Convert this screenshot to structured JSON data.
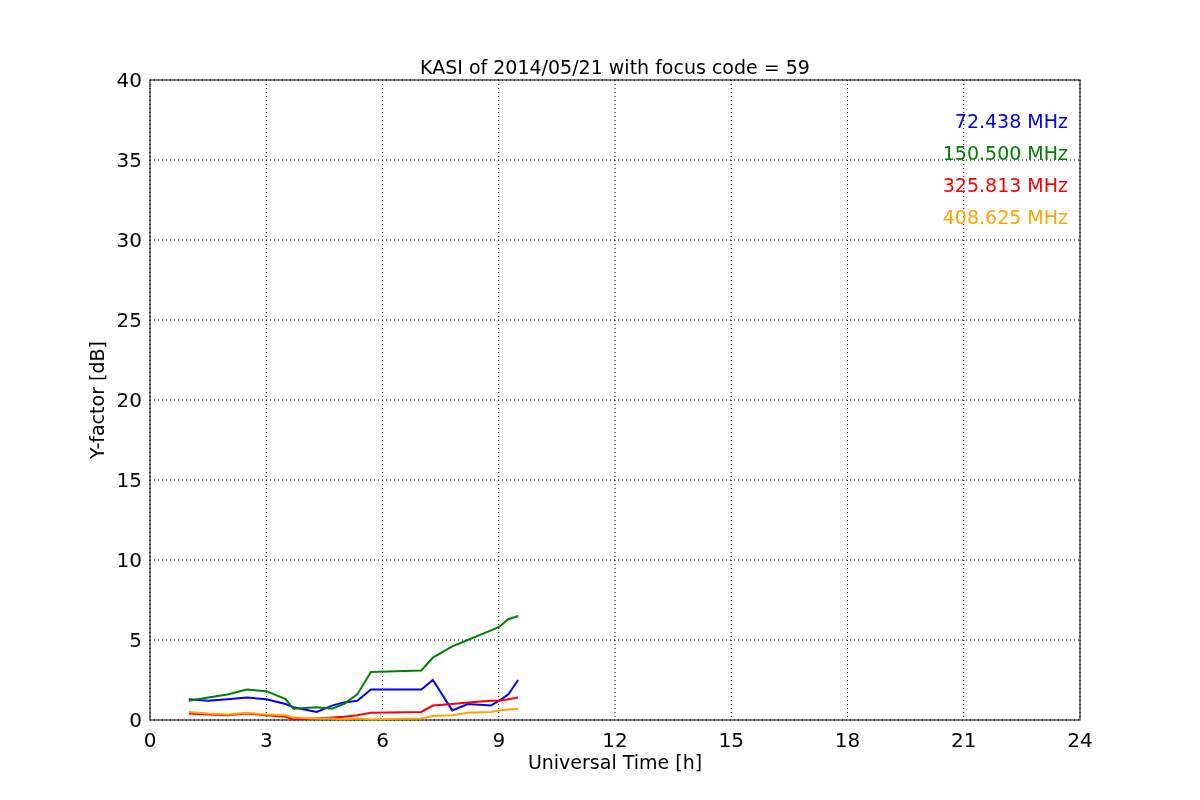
{
  "chart_data": {
    "type": "line",
    "title": "KASI of 2014/05/21 with focus code = 59",
    "xlabel": "Universal Time [h]",
    "ylabel": "Y-factor [dB]",
    "x": [
      1,
      1.5,
      2,
      2.5,
      3,
      3.5,
      3.7,
      4.3,
      4.7,
      5,
      5.35,
      5.7,
      7,
      7.3,
      7.8,
      8.2,
      8.8,
      9,
      9.25,
      9.5
    ],
    "series": [
      {
        "name": "72.438 MHz",
        "color": "#0000ff",
        "values": [
          1.3,
          1.2,
          1.3,
          1.4,
          1.3,
          1.0,
          0.8,
          0.5,
          0.9,
          1.1,
          1.2,
          1.9,
          1.9,
          2.5,
          0.6,
          1.0,
          0.9,
          1.2,
          1.6,
          2.5
        ]
      },
      {
        "name": "150.500 MHz",
        "color": "#008000",
        "values": [
          1.2,
          1.4,
          1.6,
          1.9,
          1.8,
          1.3,
          0.7,
          0.8,
          0.7,
          1.0,
          1.6,
          3.0,
          3.1,
          3.9,
          4.6,
          5.0,
          5.6,
          5.8,
          6.3,
          6.5
        ]
      },
      {
        "name": "325.813 MHz",
        "color": "#ff0000",
        "values": [
          0.4,
          0.35,
          0.3,
          0.4,
          0.3,
          0.2,
          0.05,
          0.1,
          0.15,
          0.2,
          0.3,
          0.45,
          0.5,
          0.9,
          1.0,
          1.1,
          1.2,
          1.2,
          1.3,
          1.4
        ]
      },
      {
        "name": "408.625 MHz",
        "color": "#ffa500",
        "values": [
          0.5,
          0.4,
          0.35,
          0.45,
          0.35,
          0.3,
          0.15,
          0.1,
          0.1,
          0.05,
          0.1,
          0.05,
          0.1,
          0.25,
          0.3,
          0.45,
          0.5,
          0.6,
          0.65,
          0.7
        ]
      }
    ],
    "grid": true,
    "xlim": [
      0,
      24
    ],
    "ylim": [
      0,
      40
    ],
    "xticks": [
      0,
      3,
      6,
      9,
      12,
      15,
      18,
      21,
      24
    ],
    "yticks": [
      0,
      5,
      10,
      15,
      20,
      25,
      30,
      35,
      40
    ]
  }
}
